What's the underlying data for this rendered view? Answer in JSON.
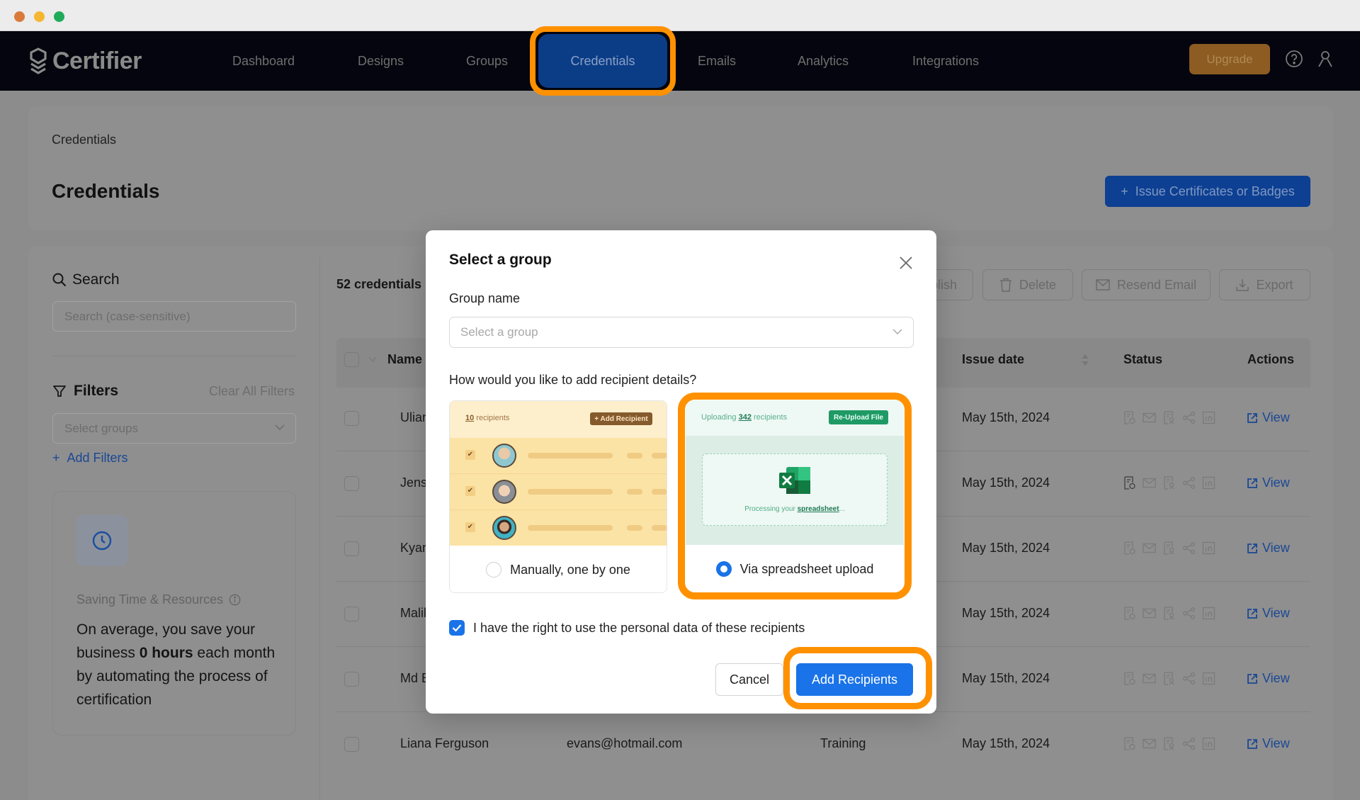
{
  "app": {
    "brand": "Certifier",
    "nav": [
      {
        "label": "Dashboard"
      },
      {
        "label": "Designs"
      },
      {
        "label": "Groups"
      },
      {
        "label": "Credentials"
      },
      {
        "label": "Emails"
      },
      {
        "label": "Analytics"
      },
      {
        "label": "Integrations"
      }
    ],
    "active_nav": "Credentials",
    "upgrade_label": "Upgrade",
    "colors": {
      "accent": "#1a73e8",
      "highlight": "#ff9100",
      "nav_bg": "#04050e"
    }
  },
  "page": {
    "breadcrumb": "Credentials",
    "title": "Credentials",
    "issue_button": "Issue Certificates or Badges"
  },
  "sidebar": {
    "search_label": "Search",
    "search_placeholder": "Search (case-sensitive)",
    "filters_label": "Filters",
    "clear_filters": "Clear All Filters",
    "groups_placeholder": "Select groups",
    "add_filters": "Add Filters",
    "saving": {
      "title": "Saving Time & Resources",
      "text_before": "On average, you save your business ",
      "text_bold": "0 hours",
      "text_after": " each month by automating the process of certification"
    }
  },
  "table": {
    "count": "52 credentials",
    "toolbar": {
      "publish": "Publish",
      "delete": "Delete",
      "resend": "Resend Email",
      "export": "Export"
    },
    "columns": {
      "name": "Name",
      "issue_date": "Issue date",
      "status": "Status",
      "actions": "Actions"
    },
    "rows": [
      {
        "name": "Uliana",
        "email": "",
        "group": "",
        "date": "May 15th, 2024",
        "action": "View"
      },
      {
        "name": "Jensen",
        "email": "",
        "group": "",
        "date": "May 15th, 2024",
        "action": "View"
      },
      {
        "name": "Kyan",
        "email": "",
        "group": "",
        "date": "May 15th, 2024",
        "action": "View"
      },
      {
        "name": "Malik",
        "email": "",
        "group": "",
        "date": "May 15th, 2024",
        "action": "View"
      },
      {
        "name": "Md E",
        "email": "",
        "group": "",
        "date": "May 15th, 2024",
        "action": "View"
      },
      {
        "name": "Liana Ferguson",
        "email": "evans@hotmail.com",
        "group": "Training",
        "date": "May 15th, 2024",
        "action": "View"
      }
    ]
  },
  "modal": {
    "title": "Select a group",
    "group_label": "Group name",
    "group_placeholder": "Select a group",
    "question": "How would you like to add recipient details?",
    "options": [
      {
        "label": "Manually, one by one",
        "selected": false,
        "preview_count": "10",
        "preview_count_suffix": " recipients",
        "preview_button": "+ Add Recipient"
      },
      {
        "label": "Via spreadsheet upload",
        "selected": true,
        "preview_prefix": "Uploading ",
        "preview_count": "342",
        "preview_count_suffix": " recipients",
        "preview_button": "Re-Upload File",
        "processing_prefix": "Processing your ",
        "processing_bold": "spreadsheet",
        "processing_suffix": "..."
      }
    ],
    "consent_label": "I have the right to use the personal data of these recipients",
    "consent_checked": true,
    "cancel": "Cancel",
    "submit": "Add Recipients"
  }
}
